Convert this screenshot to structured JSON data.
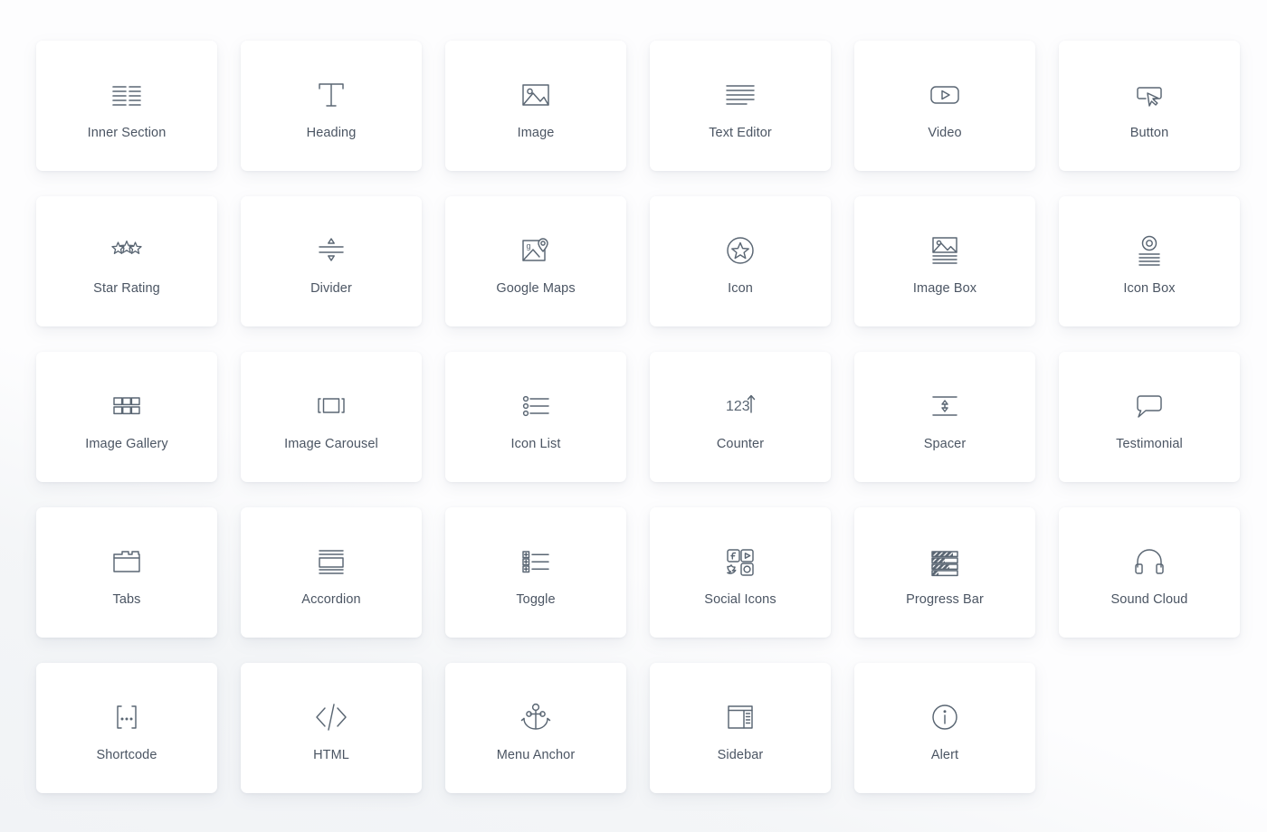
{
  "panel": {
    "name": "elementor-widgets-panel",
    "columns": 6,
    "colors": {
      "card_background": "#ffffff",
      "page_background": "#fdfdfe",
      "icon_stroke": "#5a6673",
      "label_text": "#4b5563"
    }
  },
  "widgets": [
    {
      "label": "Inner Section",
      "icon": "inner-section-icon"
    },
    {
      "label": "Heading",
      "icon": "heading-t-icon"
    },
    {
      "label": "Image",
      "icon": "image-picture-icon"
    },
    {
      "label": "Text Editor",
      "icon": "text-lines-icon"
    },
    {
      "label": "Video",
      "icon": "video-play-icon"
    },
    {
      "label": "Button",
      "icon": "button-cursor-icon"
    },
    {
      "label": "Star Rating",
      "icon": "three-stars-icon"
    },
    {
      "label": "Divider",
      "icon": "divider-arrows-icon"
    },
    {
      "label": "Google Maps",
      "icon": "map-pin-icon"
    },
    {
      "label": "Icon",
      "icon": "star-circle-icon"
    },
    {
      "label": "Image Box",
      "icon": "image-box-icon"
    },
    {
      "label": "Icon Box",
      "icon": "icon-box-circle-icon"
    },
    {
      "label": "Image Gallery",
      "icon": "gallery-grid-icon"
    },
    {
      "label": "Image Carousel",
      "icon": "carousel-slides-icon"
    },
    {
      "label": "Icon List",
      "icon": "bullet-list-icon"
    },
    {
      "label": "Counter",
      "icon": "counter-123-arrow-icon"
    },
    {
      "label": "Spacer",
      "icon": "spacer-updown-icon"
    },
    {
      "label": "Testimonial",
      "icon": "speech-bubble-icon"
    },
    {
      "label": "Tabs",
      "icon": "tabs-folder-icon"
    },
    {
      "label": "Accordion",
      "icon": "accordion-panel-icon"
    },
    {
      "label": "Toggle",
      "icon": "toggle-plus-list-icon"
    },
    {
      "label": "Social Icons",
      "icon": "social-network-icon"
    },
    {
      "label": "Progress Bar",
      "icon": "progress-bars-icon"
    },
    {
      "label": "Sound Cloud",
      "icon": "headphones-icon"
    },
    {
      "label": "Shortcode",
      "icon": "shortcode-brackets-icon"
    },
    {
      "label": "HTML",
      "icon": "code-slash-icon"
    },
    {
      "label": "Menu Anchor",
      "icon": "anchor-icon"
    },
    {
      "label": "Sidebar",
      "icon": "sidebar-layout-icon"
    },
    {
      "label": "Alert",
      "icon": "info-circle-icon"
    }
  ]
}
